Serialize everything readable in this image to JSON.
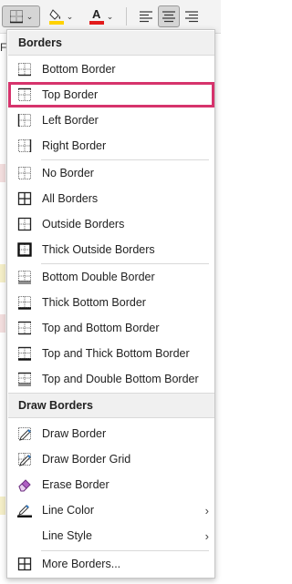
{
  "ribbon": {
    "borders_icon": "borders-icon",
    "fill_icon": "fill-color-icon",
    "font_color_icon": "font-color-icon",
    "font_color_letter": "A",
    "chevron": "⌄",
    "fill_color": "#ffd200",
    "font_color": "#e21b1b"
  },
  "sheet": {
    "partial_text": "F"
  },
  "menu": {
    "header_borders": "Borders",
    "header_draw": "Draw Borders",
    "items": [
      {
        "label": "Bottom Border",
        "icon": "bottom-border-icon"
      },
      {
        "label": "Top Border",
        "icon": "top-border-icon"
      },
      {
        "label": "Left Border",
        "icon": "left-border-icon"
      },
      {
        "label": "Right Border",
        "icon": "right-border-icon"
      },
      {
        "label": "No Border",
        "icon": "no-border-icon"
      },
      {
        "label": "All Borders",
        "icon": "all-borders-icon"
      },
      {
        "label": "Outside Borders",
        "icon": "outside-borders-icon"
      },
      {
        "label": "Thick Outside Borders",
        "icon": "thick-outside-borders-icon"
      },
      {
        "label": "Bottom Double Border",
        "icon": "bottom-double-border-icon"
      },
      {
        "label": "Thick Bottom Border",
        "icon": "thick-bottom-border-icon"
      },
      {
        "label": "Top and Bottom Border",
        "icon": "top-bottom-border-icon"
      },
      {
        "label": "Top and Thick Bottom Border",
        "icon": "top-thick-bottom-border-icon"
      },
      {
        "label": "Top and Double Bottom Border",
        "icon": "top-double-bottom-border-icon"
      }
    ],
    "draw_items": [
      {
        "label": "Draw Border",
        "icon": "draw-border-icon"
      },
      {
        "label": "Draw Border Grid",
        "icon": "draw-border-grid-icon"
      },
      {
        "label": "Erase Border",
        "icon": "eraser-icon"
      },
      {
        "label": "Line Color",
        "icon": "line-color-icon"
      },
      {
        "label": "Line Style",
        "icon": "line-style-icon"
      },
      {
        "label": "More Borders...",
        "icon": "more-borders-icon"
      }
    ],
    "submenu_arrow": "›",
    "highlight_color": "#d6336c"
  }
}
